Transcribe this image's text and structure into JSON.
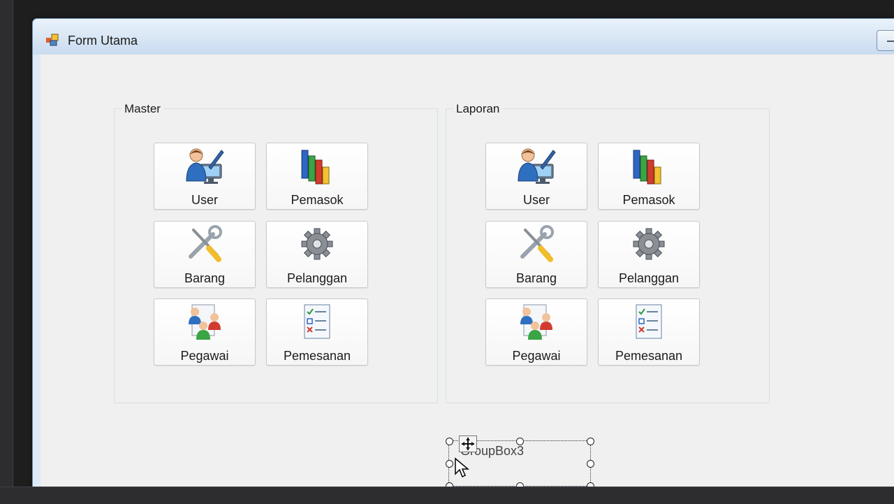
{
  "window": {
    "title": "Form Utama"
  },
  "groups": [
    {
      "title": "Master",
      "tiles": [
        {
          "label": "User",
          "icon": "user-computer-icon"
        },
        {
          "label": "Pemasok",
          "icon": "bar-chart-icon"
        },
        {
          "label": "Barang",
          "icon": "tools-icon"
        },
        {
          "label": "Pelanggan",
          "icon": "gear-icon"
        },
        {
          "label": "Pegawai",
          "icon": "people-card-icon"
        },
        {
          "label": "Pemesanan",
          "icon": "checklist-icon"
        }
      ]
    },
    {
      "title": "Laporan",
      "tiles": [
        {
          "label": "User",
          "icon": "user-computer-icon"
        },
        {
          "label": "Pemasok",
          "icon": "bar-chart-icon"
        },
        {
          "label": "Barang",
          "icon": "tools-icon"
        },
        {
          "label": "Pelanggan",
          "icon": "gear-icon"
        },
        {
          "label": "Pegawai",
          "icon": "people-card-icon"
        },
        {
          "label": "Pemesanan",
          "icon": "checklist-icon"
        }
      ]
    }
  ],
  "designer_selection": {
    "label": "GroupBox3"
  },
  "colors": {
    "titlebar": "#c9dbef",
    "client": "#f0f0f0",
    "tile_border": "#c9c9c9"
  }
}
